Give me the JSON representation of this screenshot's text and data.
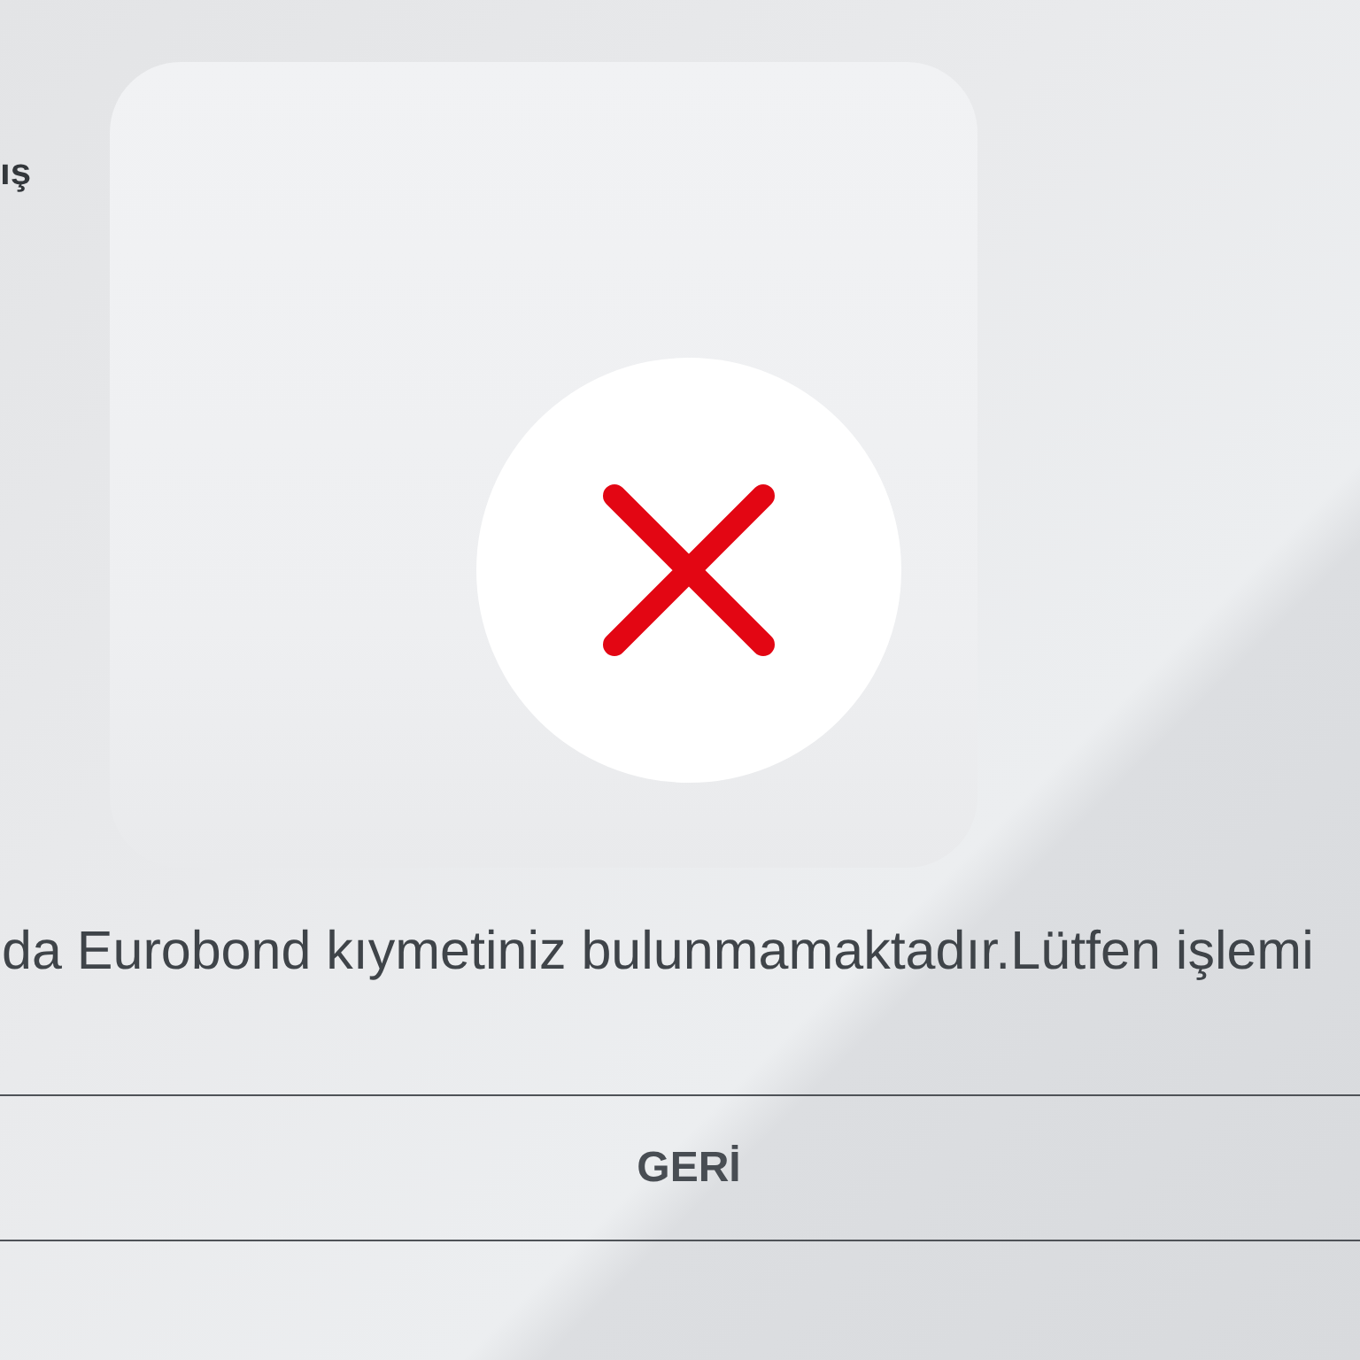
{
  "header": {
    "text": "ış"
  },
  "result": {
    "kind": "error"
  },
  "message": "da Eurobond kıymetiniz bulunmamaktadır.Lütfen işlemi",
  "button": {
    "label": "GERİ"
  }
}
